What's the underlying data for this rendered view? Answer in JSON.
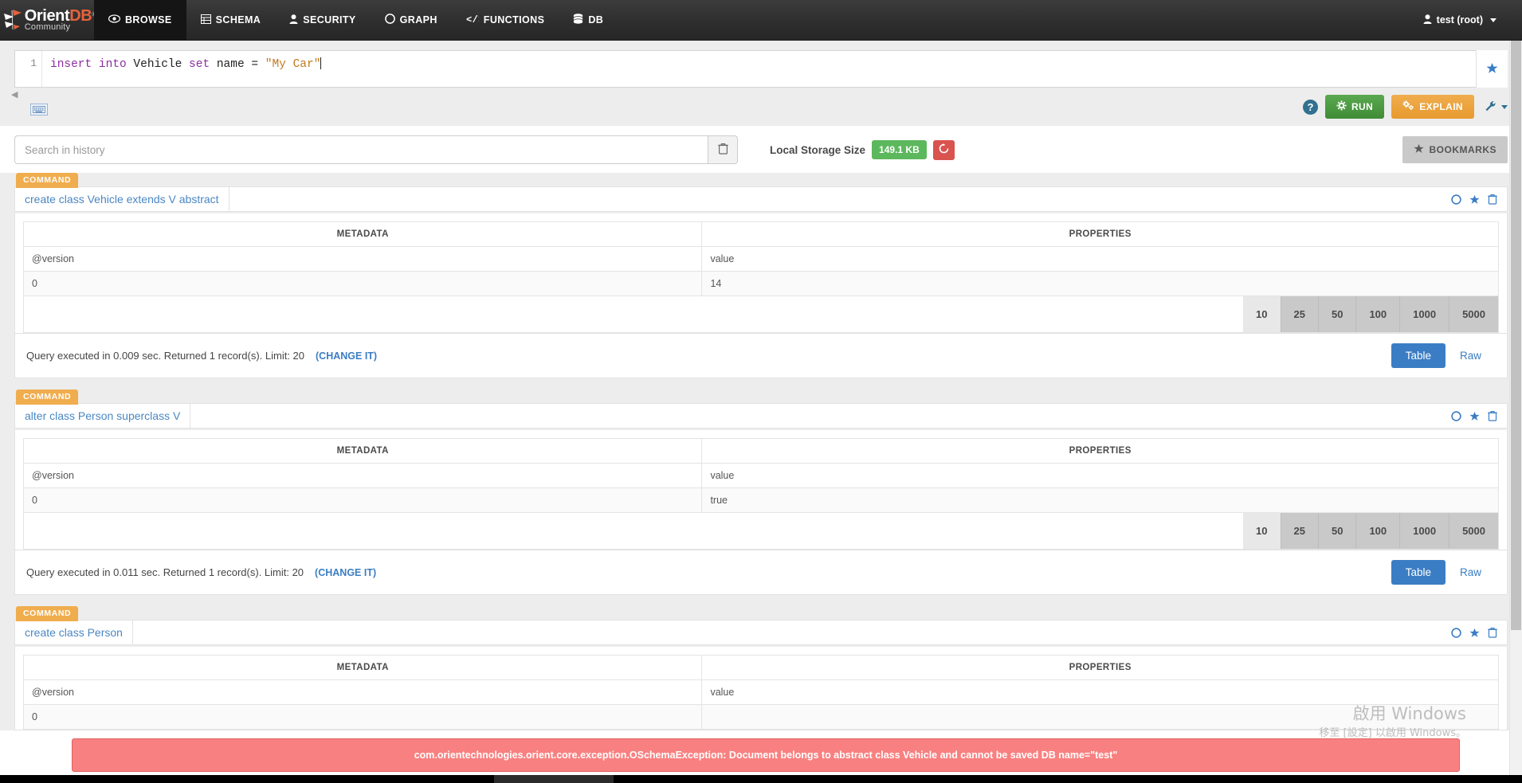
{
  "navbar": {
    "brand": {
      "orient": "Orient",
      "db": "DB",
      "reg": "®",
      "community": "Community"
    },
    "items": [
      {
        "label": "BROWSE",
        "icon": "eye-icon",
        "active": true
      },
      {
        "label": "SCHEMA",
        "icon": "table-icon",
        "active": false
      },
      {
        "label": "SECURITY",
        "icon": "user-icon",
        "active": false
      },
      {
        "label": "GRAPH",
        "icon": "circle-icon",
        "active": false
      },
      {
        "label": "FUNCTIONS",
        "icon": "code-icon",
        "active": false
      },
      {
        "label": "DB",
        "icon": "database-icon",
        "active": false
      }
    ],
    "user": {
      "label": "test (root)",
      "icon": "user-icon"
    }
  },
  "editor": {
    "line_number": "1",
    "query_tokens": [
      {
        "text": "insert into ",
        "type": "keyword"
      },
      {
        "text": "Vehicle ",
        "type": "identifier"
      },
      {
        "text": "set ",
        "type": "keyword"
      },
      {
        "text": "name = ",
        "type": "identifier"
      },
      {
        "text": "\"My Car\"",
        "type": "string"
      }
    ],
    "query_plain": "insert into Vehicle set name = \"My Car\"",
    "star_icon": "star-icon",
    "keyboard_icon": "keyboard-icon",
    "resize_icon": "resize-handle-icon"
  },
  "toolbar": {
    "help_label": "?",
    "run_label": "RUN",
    "explain_label": "EXPLAIN",
    "wrench_icon": "wrench-icon",
    "run_color": "#4a9a41",
    "explain_color": "#eda33c"
  },
  "history": {
    "search_placeholder": "Search in history",
    "search_value": "",
    "trash_icon": "trash-icon",
    "storage_label": "Local Storage Size",
    "storage_value": "149.1 KB",
    "storage_badge_color": "#5cb85c",
    "refresh_icon": "refresh-icon",
    "refresh_color": "#d9534f",
    "bookmarks_label": "BOOKMARKS",
    "bookmarks_icon": "star-icon"
  },
  "results": [
    {
      "tag": "COMMAND",
      "command": "create class Vehicle extends V abstract",
      "icons": [
        "circle-icon",
        "star-icon",
        "trash-icon"
      ],
      "columns": [
        "METADATA",
        "PROPERTIES"
      ],
      "rows": [
        [
          "@version",
          "value"
        ],
        [
          "0",
          "14"
        ]
      ],
      "pager": [
        "10",
        "25",
        "50",
        "100",
        "1000",
        "5000"
      ],
      "pager_active": "10",
      "footer_text": "Query executed in 0.009 sec. Returned 1 record(s). Limit: 20",
      "change_label": "(CHANGE IT)",
      "view_modes": [
        "Table",
        "Raw"
      ],
      "view_active": "Table"
    },
    {
      "tag": "COMMAND",
      "command": "alter class Person superclass V",
      "icons": [
        "circle-icon",
        "star-icon",
        "trash-icon"
      ],
      "columns": [
        "METADATA",
        "PROPERTIES"
      ],
      "rows": [
        [
          "@version",
          "value"
        ],
        [
          "0",
          "true"
        ]
      ],
      "pager": [
        "10",
        "25",
        "50",
        "100",
        "1000",
        "5000"
      ],
      "pager_active": "10",
      "footer_text": "Query executed in 0.011 sec. Returned 1 record(s). Limit: 20",
      "change_label": "(CHANGE IT)",
      "view_modes": [
        "Table",
        "Raw"
      ],
      "view_active": "Table"
    },
    {
      "tag": "COMMAND",
      "command": "create class Person",
      "icons": [
        "circle-icon",
        "star-icon",
        "trash-icon"
      ],
      "columns": [
        "METADATA",
        "PROPERTIES"
      ],
      "rows": [
        [
          "@version",
          "value"
        ],
        [
          "0",
          ""
        ]
      ],
      "pager": [],
      "pager_active": "",
      "footer_text": "",
      "change_label": "",
      "view_modes": [],
      "view_active": ""
    }
  ],
  "alert": {
    "message": "com.orientechnologies.orient.core.exception.OSchemaException: Document belongs to abstract class Vehicle and cannot be saved DB name=\"test\"",
    "color": "#f98080"
  },
  "watermark": {
    "title": "啟用 Windows",
    "subtitle": "移至 [設定] 以啟用 Windows。"
  }
}
